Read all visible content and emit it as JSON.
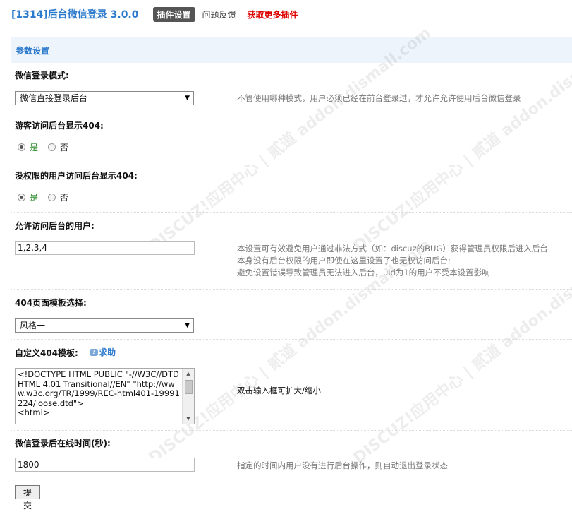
{
  "header": {
    "title": "[1314]后台微信登录 3.0.0",
    "tabs": [
      {
        "label": "插件设置",
        "active": true
      },
      {
        "label": "问题反馈",
        "active": false
      }
    ],
    "more_link": "获取更多插件"
  },
  "section": {
    "title": "参数设置"
  },
  "settings": {
    "login_mode": {
      "label": "微信登录模式:",
      "selected": "微信直接登录后台",
      "description": "不管使用哪种模式，用户必须已经在前台登录过，才允许允许使用后台微信登录"
    },
    "guest_404": {
      "label": "游客访问后台显示404:",
      "yes": "是",
      "no": "否",
      "value": "是"
    },
    "noperm_404": {
      "label": "没权限的用户访问后台显示404:",
      "yes": "是",
      "no": "否",
      "value": "是"
    },
    "allowed_users": {
      "label": "允许访问后台的用户:",
      "value": "1,2,3,4",
      "description_lines": [
        "本设置可有效避免用户通过非法方式（如：discuz的BUG）获得管理员权限后进入后台",
        "本身没有后台权限的用户即使在这里设置了也无权访问后台;",
        "避免设置错误导致管理员无法进入后台，uid为1的用户不受本设置影响"
      ]
    },
    "template_404": {
      "label": "404页面模板选择:",
      "selected": "风格一"
    },
    "custom_404": {
      "label": "自定义404模板:",
      "help_label": "求助",
      "value": "<!DOCTYPE HTML PUBLIC \"-//W3C//DTD HTML 4.01 Transitional//EN\" \"http://www.w3c.org/TR/1999/REC-html401-19991224/loose.dtd\">\n<html>",
      "description": "双击输入框可扩大/缩小"
    },
    "online_time": {
      "label": "微信登录后在线时间(秒):",
      "value": "1800",
      "description": "指定的时间内用户没有进行后台操作，则自动退出登录状态"
    }
  },
  "submit_label": "提交",
  "watermark_text": "DISCUZ!应用中心 | 贰道  addon.dismall.com",
  "colors": {
    "accent": "#2b7acd",
    "more_link": "#dd0000",
    "radio_yes": "#2a8a2a"
  }
}
